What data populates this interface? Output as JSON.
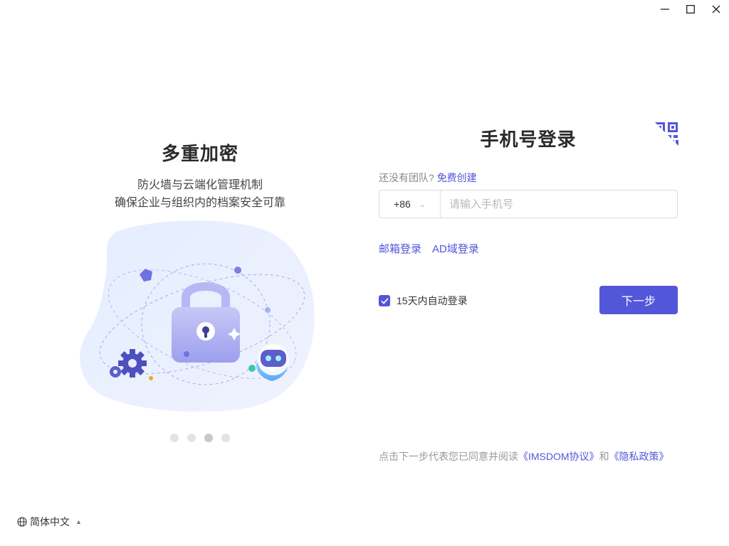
{
  "window": {
    "controls": [
      {
        "name": "minimize-icon"
      },
      {
        "name": "maximize-icon"
      },
      {
        "name": "close-icon"
      }
    ]
  },
  "carousel": {
    "title": "多重加密",
    "subtitle_line1": "防火墙与云端化管理机制",
    "subtitle_line2": "确保企业与组织内的档案安全可靠",
    "illustration_icon": "padlock-robot-illustration",
    "slide_count": 4,
    "active_slide": 3
  },
  "language": {
    "icon": "globe-icon",
    "label": "简体中文"
  },
  "login": {
    "qr_icon": "qr-code-icon",
    "title": "手机号登录",
    "no_team_text": "还没有团队?",
    "create_link": "免费创建",
    "country_code": "+86",
    "phone_placeholder": "请输入手机号",
    "phone_value": "",
    "email_login": "邮箱登录",
    "ad_login": "AD域登录",
    "remember_label": "15天内自动登录",
    "remember_checked": true,
    "next_button": "下一步",
    "agreement_prefix": "点击下一步代表您已同意并阅读",
    "agreement_link1": "《IMSDOM协议》",
    "agreement_and": "和",
    "agreement_link2": "《隐私政策》"
  },
  "colors": {
    "accent": "#5256d8",
    "muted_text": "#999999",
    "dot_inactive": "#e3e3e3",
    "dot_active": "#c8c8c8"
  }
}
